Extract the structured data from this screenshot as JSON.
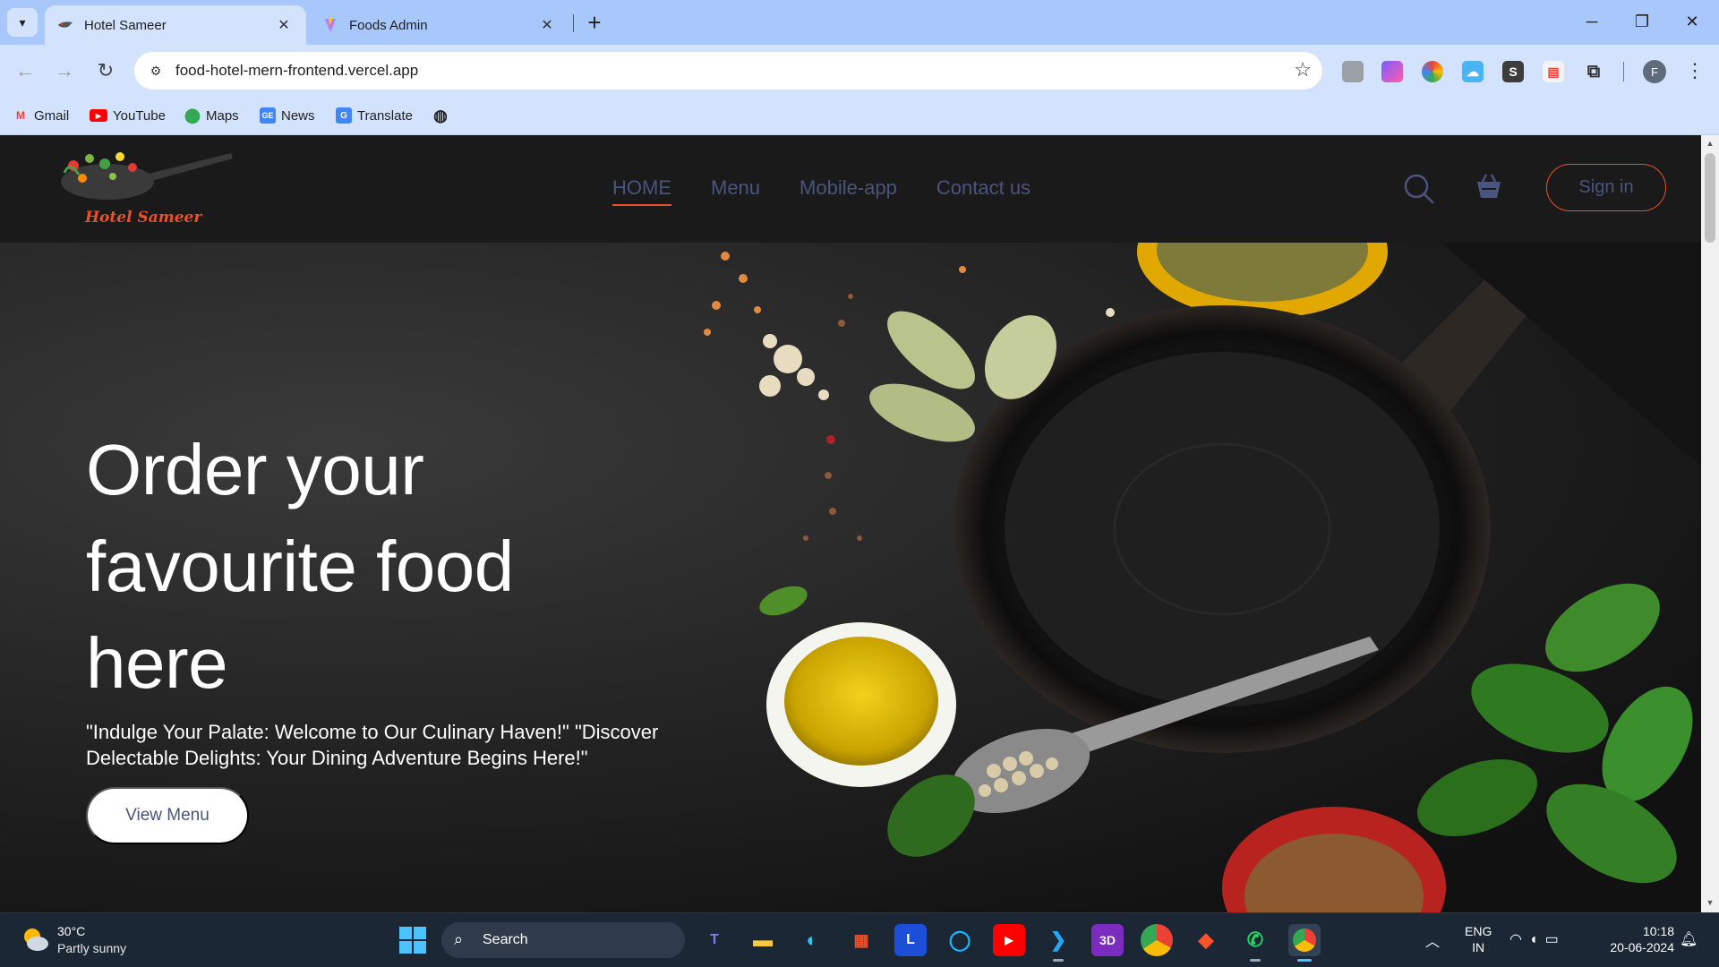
{
  "browser": {
    "tabs": [
      {
        "title": "Hotel Sameer",
        "active": true,
        "icon": "hotel-favicon"
      },
      {
        "title": "Foods Admin",
        "active": false,
        "icon": "vite-favicon"
      }
    ],
    "url": "food-hotel-mern-frontend.vercel.app",
    "bookmarks": [
      {
        "label": "Gmail",
        "icon": "gmail-icon"
      },
      {
        "label": "YouTube",
        "icon": "youtube-icon"
      },
      {
        "label": "Maps",
        "icon": "maps-icon"
      },
      {
        "label": "News",
        "icon": "news-icon"
      },
      {
        "label": "Translate",
        "icon": "translate-icon"
      }
    ],
    "profile_initial": "F"
  },
  "site": {
    "brand": "Hotel Sameer",
    "nav": {
      "links": [
        "HOME",
        "Menu",
        "Mobile-app",
        "Contact us"
      ],
      "active": "HOME",
      "signin_label": "Sign in"
    },
    "hero": {
      "title": "Order your favourite food here",
      "subtitle": "\"Indulge Your Palate: Welcome to Our Culinary Haven!\" \"Discover Delectable Delights: Your Dining Adventure Begins Here!\"",
      "cta_label": "View Menu"
    },
    "colors": {
      "accent": "#e8512b",
      "nav_text": "#49557e",
      "header_bg": "#1a1a1a"
    }
  },
  "taskbar": {
    "weather": {
      "temp": "30°C",
      "desc": "Partly sunny"
    },
    "search_label": "Search",
    "lang_line1": "ENG",
    "lang_line2": "IN",
    "time": "10:18",
    "date": "20-06-2024"
  }
}
